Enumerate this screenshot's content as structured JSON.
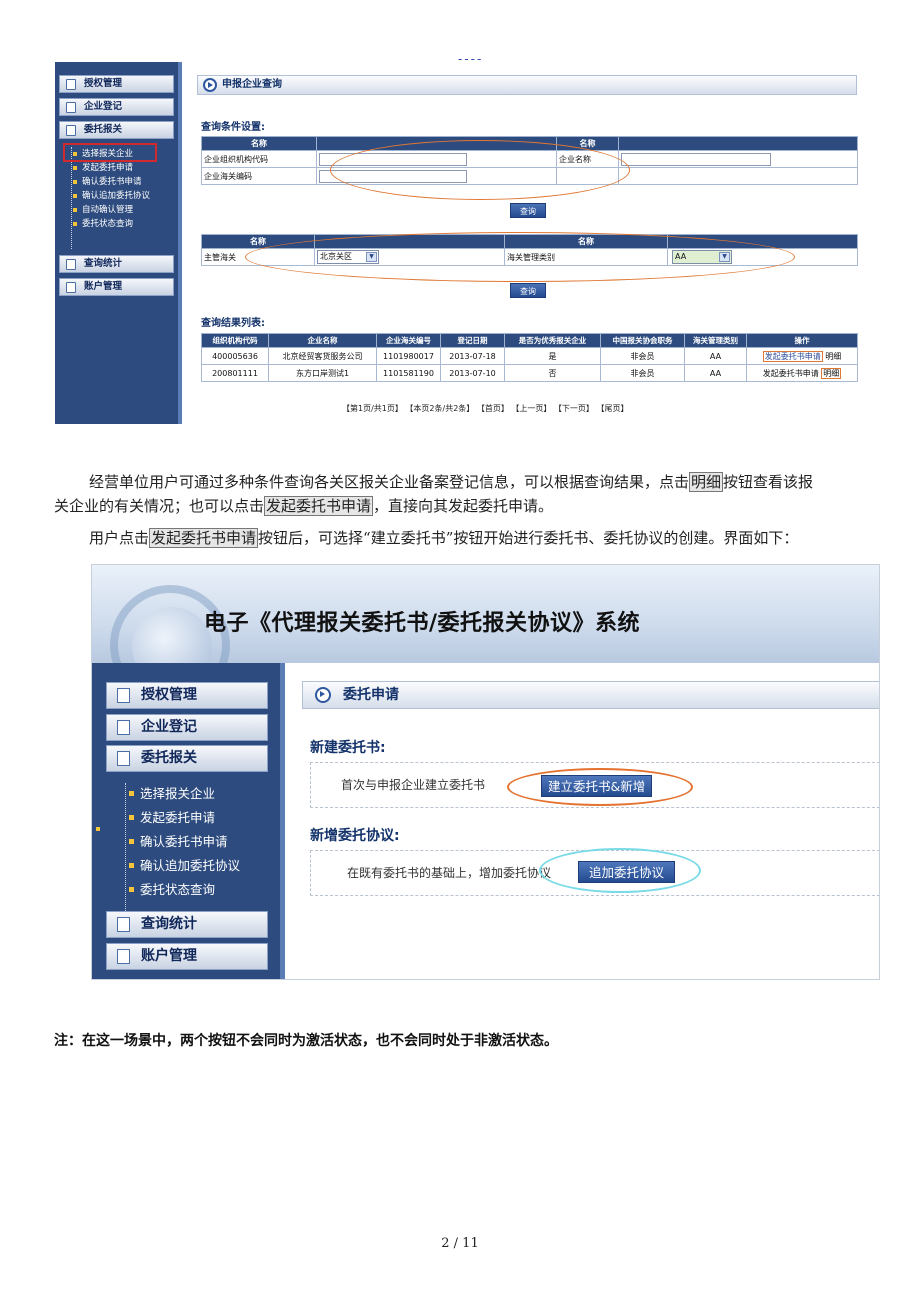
{
  "page": {
    "top_mark": "----",
    "page_number": "2 / 11"
  },
  "shot1": {
    "sidebar": {
      "menus": [
        "授权管理",
        "企业登记",
        "委托报关",
        "查询统计",
        "账户管理"
      ],
      "submenu": [
        "选择报关企业",
        "发起委托申请",
        "确认委托书申请",
        "确认追加委托协议",
        "自动确认管理",
        "委托状态查询"
      ]
    },
    "panel_title": "申报企业查询",
    "conditions_heading": "查询条件设置:",
    "cond1": {
      "col_headers": [
        "名称",
        "",
        "名称",
        ""
      ],
      "rows": [
        {
          "label1": "企业组织机构代码",
          "label2": "企业名称"
        },
        {
          "label1": "企业海关编码",
          "label2": ""
        }
      ]
    },
    "query_button": "查询",
    "cond2": {
      "col_headers": [
        "名称",
        "",
        "名称",
        ""
      ],
      "label1": "主管海关",
      "select1": "北京关区",
      "label2": "海关管理类别",
      "select2": "AA"
    },
    "results_heading": "查询结果列表:",
    "results": {
      "headers": [
        "组织机构代码",
        "企业名称",
        "企业海关编号",
        "登记日期",
        "是否为优秀报关企业",
        "中国报关协会职务",
        "海关管理类别",
        "操作"
      ],
      "rows": [
        {
          "code": "400005636",
          "name": "北京经贸客货服务公司",
          "customs_no": "1101980017",
          "date": "2013-07-18",
          "excellent": "是",
          "role": "非会员",
          "category": "AA",
          "action1": "发起委托书申请",
          "action2": "明细"
        },
        {
          "code": "200801111",
          "name": "东方口岸测试1",
          "customs_no": "1101581190",
          "date": "2013-07-10",
          "excellent": "否",
          "role": "非会员",
          "category": "AA",
          "action1": "发起委托书申请",
          "action2": "明细"
        }
      ]
    },
    "pager": "【第1页/共1页】 【本页2条/共2条】 【首页】 【上一页】 【下一页】 【尾页】"
  },
  "text": {
    "p1_line1_a": "经营单位用户可通过多种条件查询各关区报关企业备案登记信息，可以根据查询结果，点击",
    "p1_line1_btn": "明细",
    "p1_line1_b": "按钮查看该报",
    "p1_line2_a": "关企业的有关情况；也可以点击",
    "p1_line2_btn": "发起委托书申请",
    "p1_line2_b": "，直接向其发起委托申请。",
    "p2_a": "用户点击",
    "p2_btn": "发起委托书申请",
    "p2_b": "按钮后，可选择“建立委托书”按钮开始进行委托书、委托协议的创建。界面如下："
  },
  "shot2": {
    "system_title": "电子《代理报关委托书/委托报关协议》系统",
    "sidebar": {
      "menus": [
        "授权管理",
        "企业登记",
        "委托报关",
        "查询统计",
        "账户管理"
      ],
      "submenu": [
        "选择报关企业",
        "发起委托申请",
        "确认委托书申请",
        "确认追加委托协议",
        "委托状态查询"
      ]
    },
    "panel_title": "委托申请",
    "new_book_heading": "新建委托书:",
    "new_book_text": "首次与申报企业建立委托书",
    "new_book_button": "建立委托书&新增",
    "add_agreement_heading": "新增委托协议:",
    "add_agreement_text": "在既有委托书的基础上，增加委托协议",
    "add_agreement_button": "追加委托协议"
  },
  "note": "注：在这一场景中，两个按钮不会同时为激活状态，也不会同时处于非激活状态。"
}
